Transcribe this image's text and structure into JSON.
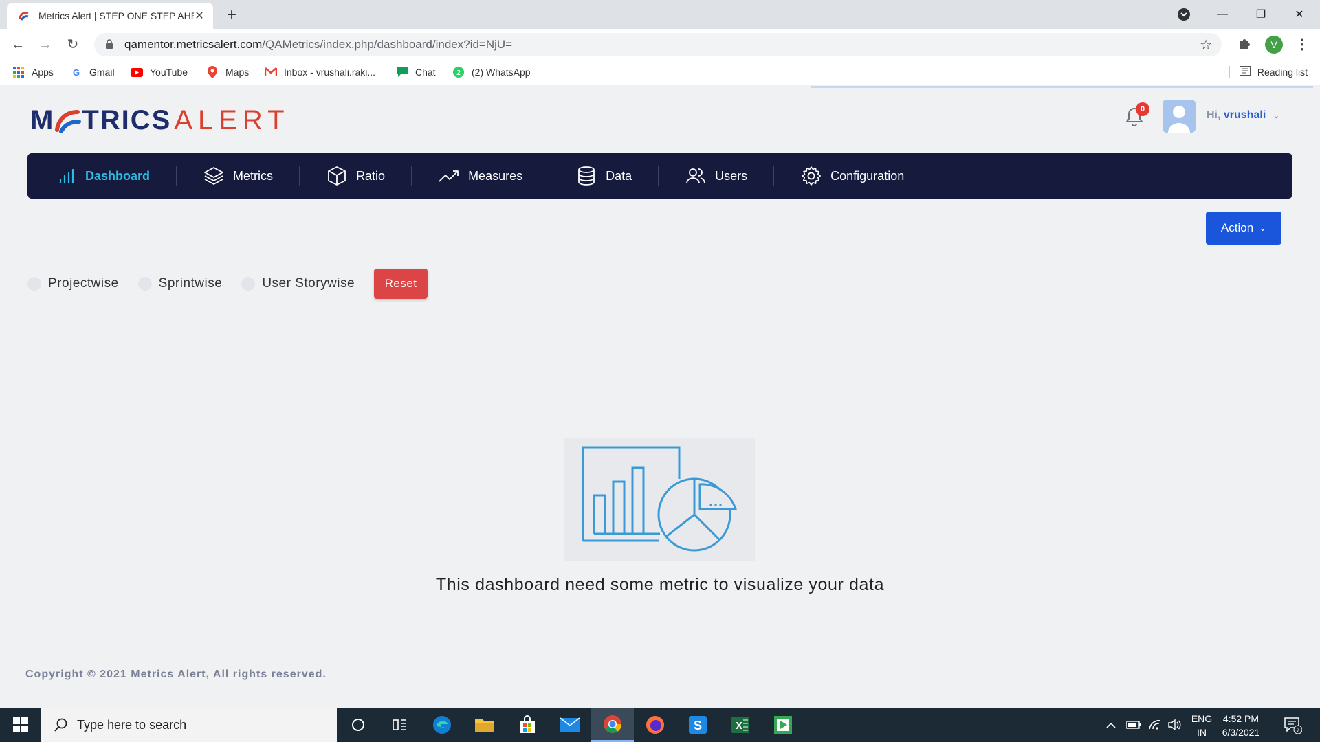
{
  "browser": {
    "tab_title": "Metrics Alert | STEP ONE STEP AHEAD",
    "url_host": "qamentor.metricsalert.com",
    "url_path": "/QAMetrics/index.php/dashboard/index?id=NjU=",
    "profile_initial": "V",
    "bookmarks": [
      "Apps",
      "Gmail",
      "YouTube",
      "Maps",
      "Inbox - vrushali.raki...",
      "Chat",
      "(2) WhatsApp"
    ],
    "reading_list": "Reading list"
  },
  "app": {
    "logo_m": "M",
    "logo_metrics": "TRICS",
    "logo_alert": "ALERT",
    "notification_count": "0",
    "greeting": "Hi,",
    "username": "vrushali",
    "nav": [
      {
        "label": "Dashboard",
        "icon": "bar-chart-icon",
        "active": true
      },
      {
        "label": "Metrics",
        "icon": "layers-icon"
      },
      {
        "label": "Ratio",
        "icon": "cube-icon"
      },
      {
        "label": "Measures",
        "icon": "trend-line-icon"
      },
      {
        "label": "Data",
        "icon": "database-icon"
      },
      {
        "label": "Users",
        "icon": "users-icon"
      },
      {
        "label": "Configuration",
        "icon": "gear-icon"
      }
    ],
    "action_label": "Action",
    "filters": [
      "Projectwise",
      "Sprintwise",
      "User Storywise"
    ],
    "reset_label": "Reset",
    "empty_message": "This dashboard need some metric to visualize your data",
    "copyright": "Copyright © 2021 Metrics Alert, All rights reserved."
  },
  "taskbar": {
    "search_placeholder": "Type here to search",
    "lang_top": "ENG",
    "lang_bottom": "IN",
    "time": "4:52 PM",
    "date": "6/3/2021",
    "notification_count": "7"
  },
  "colors": {
    "nav_bg": "#161b3e",
    "nav_active": "#2fbbe5",
    "action_btn": "#1a56db",
    "reset_btn": "#dc4545",
    "logo_blue": "#1e2d6b",
    "logo_red": "#d8412f"
  }
}
